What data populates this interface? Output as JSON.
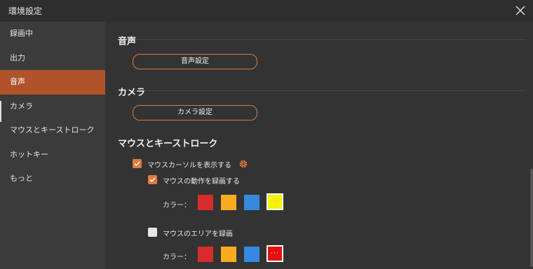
{
  "window": {
    "title": "環境設定"
  },
  "sidebar": {
    "items": [
      {
        "label": "録画中"
      },
      {
        "label": "出力"
      },
      {
        "label": "音声"
      },
      {
        "label": "カメラ"
      },
      {
        "label": "マウスとキーストローク"
      },
      {
        "label": "ホットキー"
      },
      {
        "label": "もっと"
      }
    ],
    "active_index": 2
  },
  "sections": {
    "audio": {
      "title": "音声",
      "button_label": "音声設定"
    },
    "camera": {
      "title": "カメラ",
      "button_label": "カメラ設定"
    },
    "mouse": {
      "title": "マウスとキーストローク",
      "show_cursor": {
        "label": "マウスカーソルを表示する",
        "checked": true
      },
      "record_actions": {
        "label": "マウスの動作を録画する",
        "checked": true
      },
      "record_area": {
        "label": "マウスのエリアを録画",
        "checked": false
      },
      "color_label": "カラー：",
      "action_colors": [
        "#d62c2c",
        "#f6ac1e",
        "#3589e0",
        "#f5f20e"
      ],
      "action_selected_color": "#f5f20e",
      "area_colors": [
        "#d62c2c",
        "#f6ac1e",
        "#3589e0",
        "#e51010"
      ],
      "area_selected_color": "#e51010"
    }
  },
  "colors": {
    "accent": "#e47a3c",
    "active_nav": "#b0532b"
  }
}
